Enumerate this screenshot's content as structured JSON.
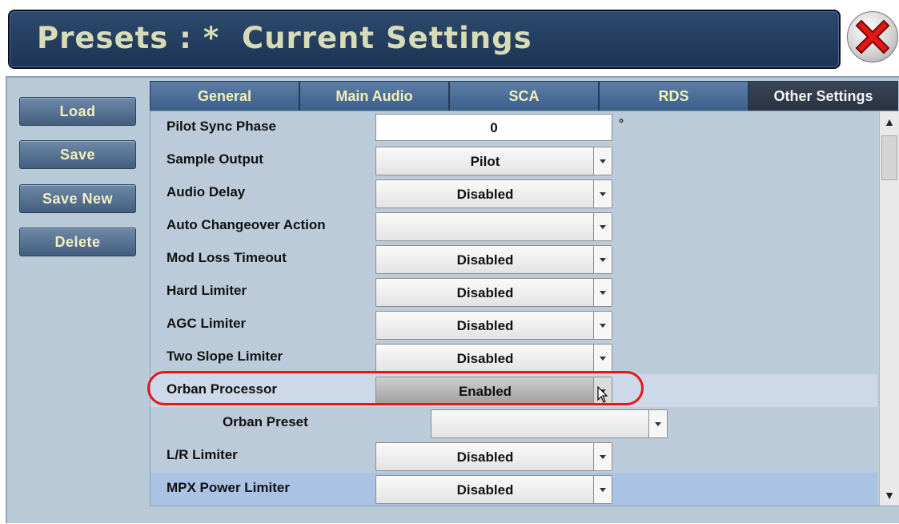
{
  "header": {
    "title": "Presets : *  Current Settings",
    "close_icon": "close-x-icon"
  },
  "sidebar": {
    "buttons": [
      {
        "label": "Load"
      },
      {
        "label": "Save"
      },
      {
        "label": "Save New"
      },
      {
        "label": "Delete"
      }
    ]
  },
  "tabs": [
    {
      "label": "General",
      "active": false
    },
    {
      "label": "Main Audio",
      "active": false
    },
    {
      "label": "SCA",
      "active": false
    },
    {
      "label": "RDS",
      "active": false
    },
    {
      "label": "Other Settings",
      "active": true
    }
  ],
  "settings": {
    "pilot_sync_phase": {
      "label": "Pilot Sync Phase",
      "value": "0",
      "unit": "°"
    },
    "sample_output": {
      "label": "Sample Output",
      "value": "Pilot"
    },
    "audio_delay": {
      "label": "Audio Delay",
      "value": "Disabled"
    },
    "auto_changeover": {
      "label": "Auto Changeover Action",
      "value": ""
    },
    "mod_loss_timeout": {
      "label": "Mod Loss Timeout",
      "value": "Disabled"
    },
    "hard_limiter": {
      "label": "Hard Limiter",
      "value": "Disabled"
    },
    "agc_limiter": {
      "label": "AGC Limiter",
      "value": "Disabled"
    },
    "two_slope_limiter": {
      "label": "Two Slope Limiter",
      "value": "Disabled"
    },
    "orban_processor": {
      "label": "Orban Processor",
      "value": "Enabled"
    },
    "orban_preset": {
      "label": "Orban Preset",
      "value": ""
    },
    "lr_limiter": {
      "label": "L/R Limiter",
      "value": "Disabled"
    },
    "mpx_power_limiter": {
      "label": "MPX Power Limiter",
      "value": "Disabled"
    }
  },
  "colors": {
    "title_text": "#d7dcb7",
    "button_text": "#f2efc0",
    "highlight_ring": "#e8161a",
    "panel_bg": "#b8c9d8"
  }
}
